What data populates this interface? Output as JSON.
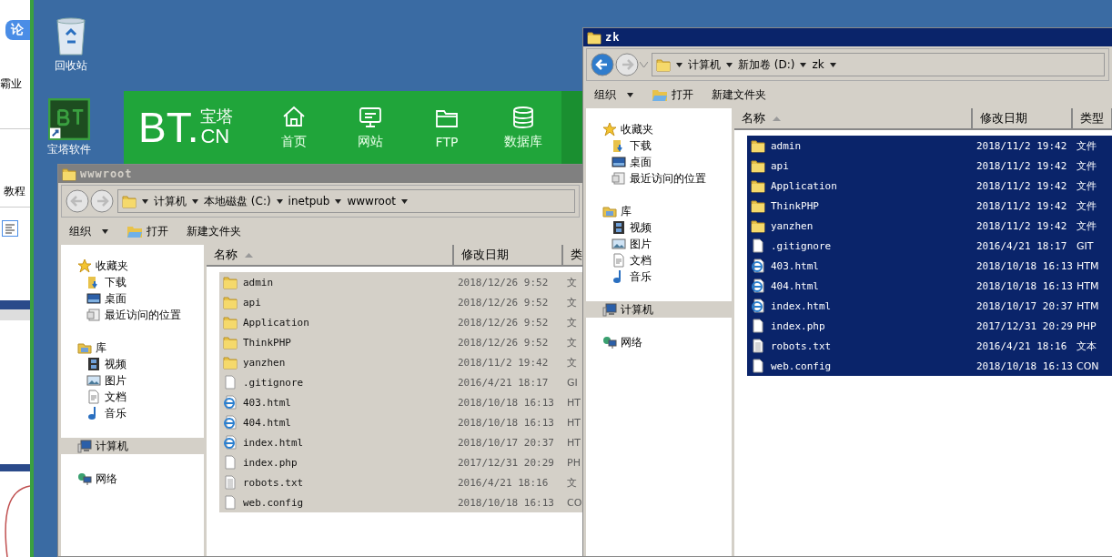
{
  "side_window": {
    "button": "论",
    "text_1": "霸业",
    "text_2": "教程"
  },
  "desktop_icons": [
    {
      "label": "回收站",
      "kind": "recycle"
    },
    {
      "label": "宝塔软件",
      "kind": "bt"
    }
  ],
  "bt_panel": {
    "logo": "BT.",
    "logo_cn": "宝塔",
    "logo_sub": "CN",
    "nav": [
      {
        "label": "首页",
        "kind": "home"
      },
      {
        "label": "网站",
        "kind": "site"
      },
      {
        "label": "FTP",
        "kind": "ftp"
      },
      {
        "label": "数据库",
        "kind": "database"
      }
    ]
  },
  "windows": [
    {
      "title": "wwwroot",
      "active": false,
      "back_disabled": true,
      "address": [
        "计算机",
        "本地磁盘 (C:)",
        "inetpub",
        "wwwroot"
      ],
      "toolbar": [
        {
          "label": "组织",
          "kind": "menu"
        },
        {
          "label": "打开",
          "kind": "open"
        },
        {
          "label": "新建文件夹",
          "kind": "plain"
        }
      ],
      "nav": [
        {
          "label": "收藏夹",
          "kind": "star",
          "selected": false,
          "children": [
            {
              "label": "下载",
              "kind": "download",
              "selected": false
            },
            {
              "label": "桌面",
              "kind": "desktop",
              "selected": false
            },
            {
              "label": "最近访问的位置",
              "kind": "recent",
              "selected": false
            }
          ]
        },
        {
          "label": "库",
          "kind": "library",
          "selected": false,
          "children": [
            {
              "label": "视频",
              "kind": "video",
              "selected": false
            },
            {
              "label": "图片",
              "kind": "picture",
              "selected": false
            },
            {
              "label": "文档",
              "kind": "document",
              "selected": false
            },
            {
              "label": "音乐",
              "kind": "music",
              "selected": false
            }
          ]
        },
        {
          "label": "计算机",
          "kind": "computer",
          "selected": true
        },
        {
          "label": "网络",
          "kind": "network",
          "selected": false
        }
      ],
      "columns": [
        "名称",
        "修改日期",
        "类"
      ],
      "rows": [
        {
          "name": "admin",
          "kind": "folder",
          "date": "2018/12/26 9:52",
          "type": "文",
          "selected": true
        },
        {
          "name": "api",
          "kind": "folder",
          "date": "2018/12/26 9:52",
          "type": "文",
          "selected": true
        },
        {
          "name": "Application",
          "kind": "folder",
          "date": "2018/12/26 9:52",
          "type": "文",
          "selected": true
        },
        {
          "name": "ThinkPHP",
          "kind": "folder",
          "date": "2018/12/26 9:52",
          "type": "文",
          "selected": true
        },
        {
          "name": "yanzhen",
          "kind": "folder",
          "date": "2018/11/2 19:42",
          "type": "文",
          "selected": true
        },
        {
          "name": ".gitignore",
          "kind": "file",
          "date": "2016/4/21 18:17",
          "type": "GI",
          "selected": true
        },
        {
          "name": "403.html",
          "kind": "web",
          "date": "2018/10/18 16:13",
          "type": "HT",
          "selected": true
        },
        {
          "name": "404.html",
          "kind": "web",
          "date": "2018/10/18 16:13",
          "type": "HT",
          "selected": true
        },
        {
          "name": "index.html",
          "kind": "web",
          "date": "2018/10/17 20:37",
          "type": "HT",
          "selected": true
        },
        {
          "name": "index.php",
          "kind": "file",
          "date": "2017/12/31 20:29",
          "type": "PH",
          "selected": true
        },
        {
          "name": "robots.txt",
          "kind": "text",
          "date": "2016/4/21 18:16",
          "type": "文",
          "selected": true
        },
        {
          "name": "web.config",
          "kind": "file",
          "date": "2018/10/18 16:13",
          "type": "CO",
          "selected": true
        }
      ]
    },
    {
      "title": "zk",
      "active": true,
      "back_disabled": false,
      "address": [
        "计算机",
        "新加卷 (D:)",
        "zk"
      ],
      "toolbar": [
        {
          "label": "组织",
          "kind": "menu"
        },
        {
          "label": "打开",
          "kind": "open"
        },
        {
          "label": "新建文件夹",
          "kind": "plain"
        }
      ],
      "nav": [
        {
          "label": "收藏夹",
          "kind": "star",
          "selected": false,
          "children": [
            {
              "label": "下载",
              "kind": "download",
              "selected": false
            },
            {
              "label": "桌面",
              "kind": "desktop",
              "selected": false
            },
            {
              "label": "最近访问的位置",
              "kind": "recent",
              "selected": false
            }
          ]
        },
        {
          "label": "库",
          "kind": "library",
          "selected": false,
          "children": [
            {
              "label": "视频",
              "kind": "video",
              "selected": false
            },
            {
              "label": "图片",
              "kind": "picture",
              "selected": false
            },
            {
              "label": "文档",
              "kind": "document",
              "selected": false
            },
            {
              "label": "音乐",
              "kind": "music",
              "selected": false
            }
          ]
        },
        {
          "label": "计算机",
          "kind": "computer",
          "selected": true
        },
        {
          "label": "网络",
          "kind": "network",
          "selected": false
        }
      ],
      "columns": [
        "名称",
        "修改日期",
        "类型"
      ],
      "rows": [
        {
          "name": "admin",
          "kind": "folder",
          "date": "2018/11/2 19:42",
          "type": "文件",
          "selected": true
        },
        {
          "name": "api",
          "kind": "folder",
          "date": "2018/11/2 19:42",
          "type": "文件",
          "selected": true
        },
        {
          "name": "Application",
          "kind": "folder",
          "date": "2018/11/2 19:42",
          "type": "文件",
          "selected": true
        },
        {
          "name": "ThinkPHP",
          "kind": "folder",
          "date": "2018/11/2 19:42",
          "type": "文件",
          "selected": true
        },
        {
          "name": "yanzhen",
          "kind": "folder",
          "date": "2018/11/2 19:42",
          "type": "文件",
          "selected": true
        },
        {
          "name": ".gitignore",
          "kind": "file",
          "date": "2016/4/21 18:17",
          "type": "GIT",
          "selected": true
        },
        {
          "name": "403.html",
          "kind": "web",
          "date": "2018/10/18 16:13",
          "type": "HTM",
          "selected": true
        },
        {
          "name": "404.html",
          "kind": "web",
          "date": "2018/10/18 16:13",
          "type": "HTM",
          "selected": true
        },
        {
          "name": "index.html",
          "kind": "web",
          "date": "2018/10/17 20:37",
          "type": "HTM",
          "selected": true
        },
        {
          "name": "index.php",
          "kind": "file",
          "date": "2017/12/31 20:29",
          "type": "PHP",
          "selected": true
        },
        {
          "name": "robots.txt",
          "kind": "text",
          "date": "2016/4/21 18:16",
          "type": "文本",
          "selected": true
        },
        {
          "name": "web.config",
          "kind": "file",
          "date": "2018/10/18 16:13",
          "type": "CON",
          "selected": true
        }
      ]
    }
  ]
}
